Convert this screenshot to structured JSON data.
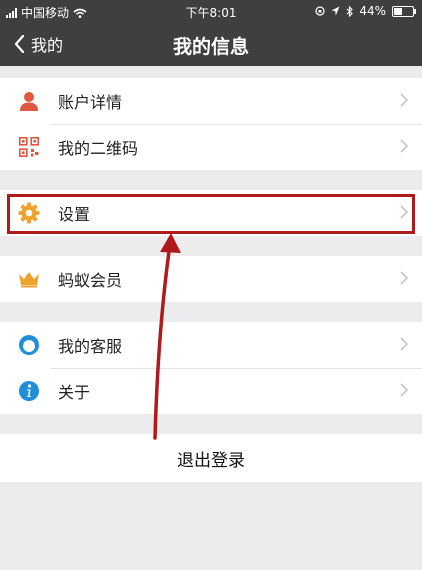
{
  "status_bar": {
    "carrier": "中国移动",
    "time": "下午8:01",
    "battery": "44%",
    "battery_level": 0.44
  },
  "nav": {
    "back_label": "我的",
    "title": "我的信息"
  },
  "menu": {
    "account_details": "账户详情",
    "qr_code": "我的二维码",
    "settings": "设置",
    "ant_member": "蚂蚁会员",
    "customer_service": "我的客服",
    "about": "关于"
  },
  "logout_label": "退出登录",
  "colors": {
    "nav_background": "#3f3f3f",
    "highlight": "#b01a1a",
    "icon_red": "#e1573f",
    "icon_orange": "#f0a22e",
    "icon_blue": "#1e8fd8"
  },
  "icons": [
    "back-chevron-icon",
    "person-icon",
    "qr-code-icon",
    "gear-icon",
    "crown-icon",
    "headset-icon",
    "info-icon",
    "chevron-right-icon"
  ]
}
